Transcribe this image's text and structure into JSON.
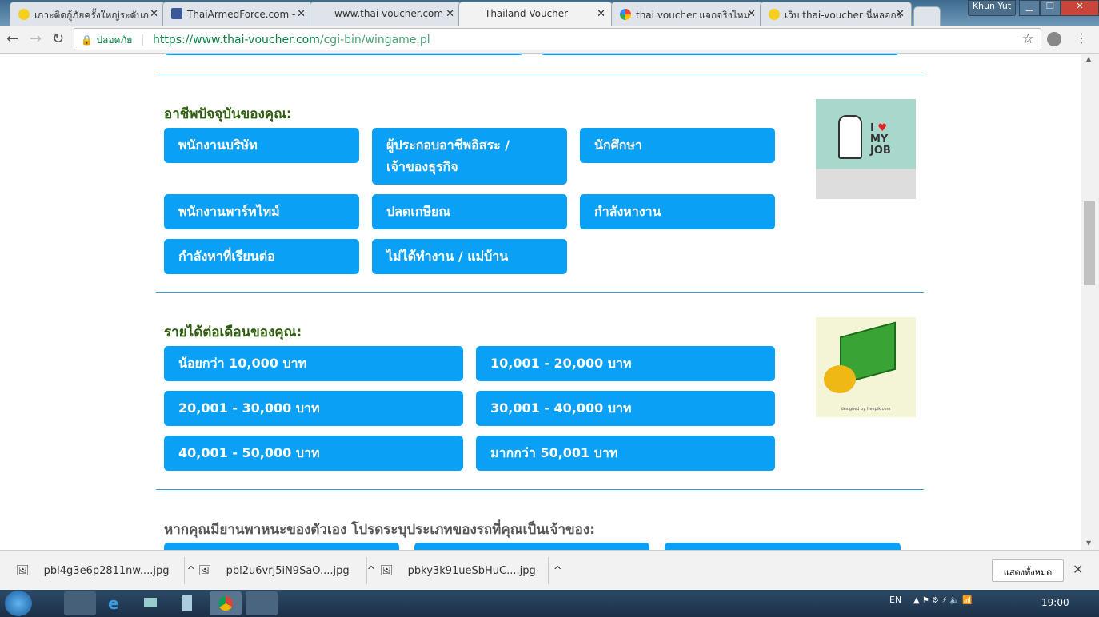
{
  "browser": {
    "tabs": [
      {
        "title": "เกาะติดกู้ภัยครั้งใหญ่ระดับภ",
        "icon": "smiley-icon",
        "active": false
      },
      {
        "title": "ThaiArmedForce.com - ",
        "icon": "facebook-icon",
        "active": false
      },
      {
        "title": "www.thai-voucher.com",
        "icon": "",
        "active": false
      },
      {
        "title": "Thailand Voucher",
        "icon": "",
        "active": true
      },
      {
        "title": "thai voucher แจกจริงไหม",
        "icon": "google-icon",
        "active": false
      },
      {
        "title": "เว็บ thai-voucher นี่หลอกร",
        "icon": "smiley-icon",
        "active": false
      }
    ],
    "profile": "Khun Yut",
    "secure_label": "ปลอดภัย",
    "url_host": "https://www.thai-voucher.com",
    "url_path": "/cgi-bin/wingame.pl"
  },
  "occupation": {
    "heading": "อาชีพปัจจุบันของคุณ:",
    "options": [
      "พนักงานบริษัท",
      "ผู้ประกอบอาชีพอิสระ / เจ้าของธุรกิจ",
      "นักศึกษา",
      "พนักงานพาร์ทไทม์",
      "ปลดเกษียณ",
      "กำลังหางาน",
      "กำลังหาที่เรียนต่อ",
      "ไม่ได้ทำงาน / แม่บ้าน"
    ],
    "image_text": "I ♥ MY JOB"
  },
  "income": {
    "heading": "รายได้ต่อเดือนของคุณ:",
    "options": [
      "น้อยกว่า 10,000 บาท",
      "10,001 - 20,000 บาท",
      "20,001 - 30,000 บาท",
      "30,001 - 40,000 บาท",
      "40,001 - 50,000 บาท",
      "มากกว่า 50,001 บาท"
    ],
    "image_text": "designed by freepik.com"
  },
  "vehicle": {
    "heading": "หากคุณมียานพาหนะของตัวเอง โปรดระบุประเภทของรถที่คุณเป็นเจ้าของ:"
  },
  "downloads": {
    "items": [
      "pbl4g3e6p2811nw....jpg",
      "pbl2u6vrj5iN9SaO....jpg",
      "pbky3k91ueSbHuC....jpg"
    ],
    "show_all": "แสดงทั้งหมด"
  },
  "taskbar": {
    "lang": "EN",
    "time": "19:00"
  },
  "colors": {
    "button": "#0aa0f5",
    "heading": "#2e5e0e",
    "divider": "#3a9bd5"
  }
}
